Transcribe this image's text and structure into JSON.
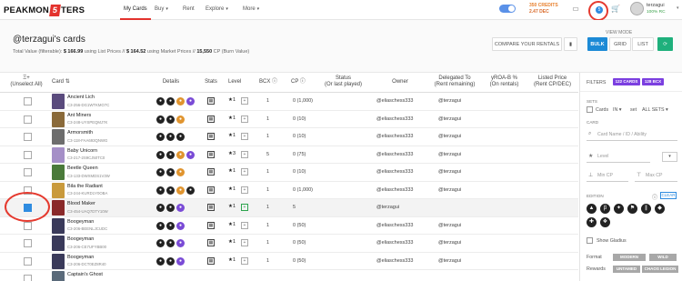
{
  "nav": {
    "logo_pre": "PEAKMON",
    "logo_mid": "5",
    "logo_post": "TERS",
    "items": [
      {
        "label": "My Cards",
        "active": true
      },
      {
        "label": "Buy",
        "caret": true
      },
      {
        "label": "Rent"
      },
      {
        "label": "Explore",
        "caret": true
      },
      {
        "label": "More",
        "caret": true
      }
    ],
    "credits": "350 CREDITS",
    "dec": "2.47 DEC",
    "notif_count": "5",
    "username": "terzagui",
    "rc": "100% RC"
  },
  "header": {
    "title": "@terzagui's cards",
    "total_value_label": "Total Value (filterable): ",
    "total_list": "$ 166.99",
    "list_suffix": " using List Prices // ",
    "total_market": "$ 164.52",
    "market_suffix": " using Market Prices // ",
    "cp": "15,550",
    "cp_suffix": " CP (Burn Value)",
    "viewmode_label": "VIEW MODE",
    "compare_label": "COMPARE YOUR RENTALS",
    "bulk": "BULK",
    "grid": "GRID",
    "list": "LIST"
  },
  "table": {
    "headers": {
      "select": "Ξ+",
      "select2": "(Unselect All)",
      "card": "Card",
      "details": "Details",
      "stats": "Stats",
      "level": "Level",
      "bcx": "BCX",
      "cp": "CP",
      "status": "Status",
      "status2": "(Or last played)",
      "owner": "Owner",
      "delegated": "Delegated To",
      "delegated2": "(Rent remaining)",
      "yroa": "yROA-B %",
      "yroa2": "(On rentals)",
      "listed": "Listed Price",
      "listed2": "(Rent CP/DEC)"
    },
    "rows": [
      {
        "name": "Ancient Lich",
        "uid": "C3-256-DG1WTKMO7C",
        "level": "1",
        "bcx": "1",
        "cp": "0 (1,000)",
        "owner": "@eliaschess333",
        "delegated": "@terzagui",
        "color": "#5a4b7d",
        "icons": [
          "#222",
          "#222",
          "#e0942e",
          "#7a4bd6"
        ]
      },
      {
        "name": "Ant Miners",
        "uid": "C3-248-UYSPEQMJ7K",
        "level": "1",
        "bcx": "1",
        "cp": "0 (10)",
        "owner": "@eliaschess333",
        "delegated": "@terzagui",
        "color": "#8a6a3a",
        "icons": [
          "#222",
          "#222",
          "#e0942e"
        ]
      },
      {
        "name": "Armorsmith",
        "uid": "C3-118-FAA693QNWG",
        "level": "1",
        "bcx": "1",
        "cp": "0 (10)",
        "owner": "@eliaschess333",
        "delegated": "@terzagui",
        "color": "#6d6d6d",
        "icons": [
          "#222",
          "#222",
          "#222"
        ]
      },
      {
        "name": "Baby Unicorn",
        "uid": "C3-217-2S9CJ50TC0",
        "level": "3",
        "bcx": "5",
        "cp": "0 (75)",
        "owner": "@eliaschess333",
        "delegated": "@terzagui",
        "color": "#a58fc7",
        "icons": [
          "#222",
          "#222",
          "#e0942e",
          "#7a4bd6"
        ]
      },
      {
        "name": "Beetle Queen",
        "uid": "C3-133-DWXMDS1V3W",
        "level": "1",
        "bcx": "1",
        "cp": "0 (10)",
        "owner": "@eliaschess333",
        "delegated": "@terzagui",
        "color": "#4a7a3a",
        "icons": [
          "#222",
          "#222",
          "#e0942e"
        ]
      },
      {
        "name": "Bila the Radiant",
        "uid": "C3-244-KURD1Y0OBA",
        "level": "1",
        "bcx": "1",
        "cp": "0 (1,000)",
        "owner": "@eliaschess333",
        "delegated": "@terzagui",
        "color": "#c99a3c",
        "icons": [
          "#222",
          "#222",
          "#e0942e",
          "#222"
        ]
      },
      {
        "name": "Blood Maker",
        "uid": "C3-454-UAQ7DTY10W",
        "level": "1",
        "bcx": "1",
        "cp": "5",
        "owner": "@terzagui",
        "delegated": "",
        "color": "#8a2a2a",
        "icons": [
          "#222",
          "#222",
          "#7a4bd6"
        ],
        "highlight": true,
        "checked": true,
        "green": true
      },
      {
        "name": "Boogeyman",
        "uid": "C3-206-BEENLJCUDC",
        "level": "1",
        "bcx": "1",
        "cp": "0 (50)",
        "owner": "@eliaschess333",
        "delegated": "@terzagui",
        "color": "#3a3a5a",
        "icons": [
          "#222",
          "#222",
          "#7a4bd6"
        ]
      },
      {
        "name": "Boogeyman",
        "uid": "C3-206-CE7UFYBB00",
        "level": "1",
        "bcx": "1",
        "cp": "0 (50)",
        "owner": "@eliaschess333",
        "delegated": "@terzagui",
        "color": "#3a3a5a",
        "icons": [
          "#222",
          "#222",
          "#7a4bd6"
        ]
      },
      {
        "name": "Boogeyman",
        "uid": "C3-206-DCT0EZ8R40",
        "level": "1",
        "bcx": "1",
        "cp": "0 (50)",
        "owner": "@eliaschess333",
        "delegated": "@terzagui",
        "color": "#3a3a5a",
        "icons": [
          "#222",
          "#222",
          "#7a4bd6"
        ]
      },
      {
        "name": "Captain's Ghost",
        "uid": "",
        "level": "",
        "bcx": "",
        "cp": "",
        "owner": "",
        "delegated": "",
        "color": "#5a6a7a",
        "icons": []
      }
    ]
  },
  "filters": {
    "title": "FILTERS",
    "cards_count": "122 CARDS",
    "bcx_count": "128 BCX",
    "sets_label": "SETS",
    "cards_cb": "Cards",
    "in": "IN",
    "set": "set",
    "all_sets": "ALL SETS",
    "card_label": "CARD",
    "card_placeholder": "Card Name / ID / Ability",
    "level_placeholder": "Level",
    "min_cp": "Min CP",
    "max_cp": "Max CP",
    "edition_label": "EDITION",
    "clear": "CLEAR",
    "show_gladius": "Show Gladius",
    "format_label": "Format",
    "modern": "MODERN",
    "wild": "WILD",
    "rewards_label": "Rewards",
    "untamed": "UNTAMED",
    "chaos": "CHAOS LEGION"
  }
}
